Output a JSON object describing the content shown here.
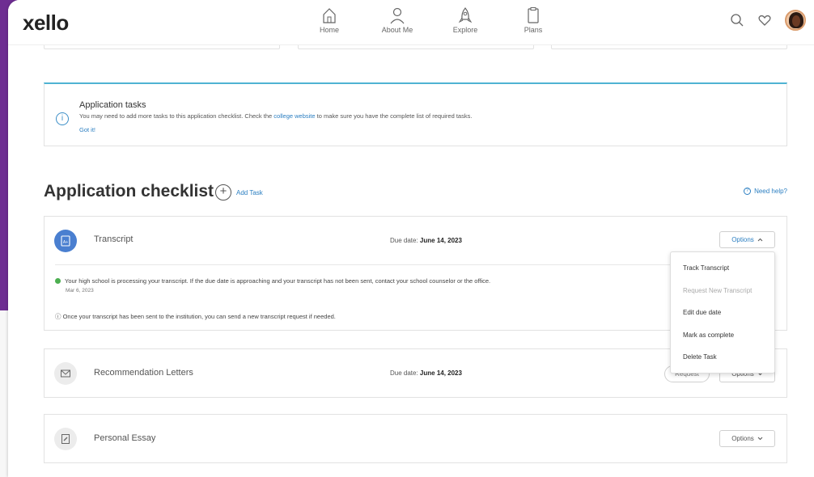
{
  "app": {
    "logo": "xello"
  },
  "nav": {
    "items": [
      {
        "label": "Home",
        "icon": "home-icon"
      },
      {
        "label": "About Me",
        "icon": "person-icon"
      },
      {
        "label": "Explore",
        "icon": "rocket-icon"
      },
      {
        "label": "Plans",
        "icon": "clipboard-icon"
      }
    ],
    "right_icons": [
      "search-icon",
      "heart-icon",
      "avatar"
    ]
  },
  "colors": {
    "brand_purple": "#6e2d92",
    "accent_blue": "#2a7ec1",
    "info_border": "#4fb3d3",
    "success_green": "#4caf50"
  },
  "info_box": {
    "title": "Application tasks",
    "text_before": "You may need to add more tasks to this application checklist. Check the ",
    "link": "college website",
    "text_after": " to make sure you have the complete list of required tasks.",
    "got_it": "Got it!"
  },
  "checklist": {
    "heading": "Application checklist",
    "add_task": "Add Task",
    "need_help": "Need help?"
  },
  "tasks": [
    {
      "name": "Transcript",
      "due_label": "Due date: ",
      "due_date": "June 14, 2023",
      "options_label": "Options",
      "status_text": "Your high school is processing your transcript. If the due date is approaching and your transcript has not been sent, contact your school counselor or the office.",
      "status_date": "Mar 6, 2023",
      "note": "Once your transcript has been sent to the institution, you can send a new transcript request if needed."
    },
    {
      "name": "Recommendation Letters",
      "due_label": "Due date: ",
      "due_date": "June 14, 2023",
      "request_label": "Request",
      "options_label": "Options"
    },
    {
      "name": "Personal Essay",
      "options_label": "Options"
    }
  ],
  "options_menu": {
    "items": [
      {
        "label": "Track Transcript",
        "disabled": false
      },
      {
        "label": "Request New Transcript",
        "disabled": true
      },
      {
        "label": "Edit due date",
        "disabled": false
      },
      {
        "label": "Mark as complete",
        "disabled": false
      },
      {
        "label": "Delete Task",
        "disabled": false
      }
    ]
  }
}
